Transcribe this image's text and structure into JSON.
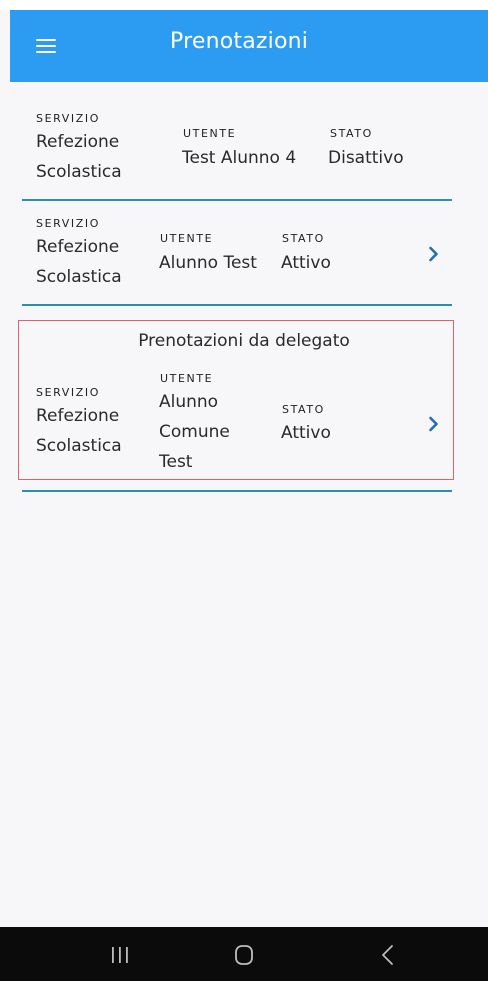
{
  "app_bar": {
    "title": "Prenotazioni",
    "menu_icon": "hamburger-menu-icon",
    "background": "#2c9cf2"
  },
  "labels": {
    "service": "SERVIZIO",
    "user": "UTENTE",
    "status": "STATO"
  },
  "bookings": [
    {
      "service_line1": "Refezione",
      "service_line2": "Scolastica",
      "user": "Test Alunno 4",
      "status": "Disattivo",
      "has_chevron": false
    },
    {
      "service_line1": "Refezione",
      "service_line2": "Scolastica",
      "user": "Alunno Test",
      "status": "Attivo",
      "has_chevron": true
    }
  ],
  "delegate_section": {
    "title": "Prenotazioni da delegato",
    "booking": {
      "service_line1": "Refezione",
      "service_line2": "Scolastica",
      "user_line1": "Alunno",
      "user_line2": "Comune",
      "user_line3": "Test",
      "status": "Attivo",
      "has_chevron": true
    }
  },
  "colors": {
    "divider": "#2b8fae",
    "chevron": "#1f6fb2",
    "highlight_border": "#d9666e"
  },
  "system_nav": {
    "recent_icon": "recent-apps-icon",
    "home_icon": "home-icon",
    "back_icon": "back-icon"
  }
}
